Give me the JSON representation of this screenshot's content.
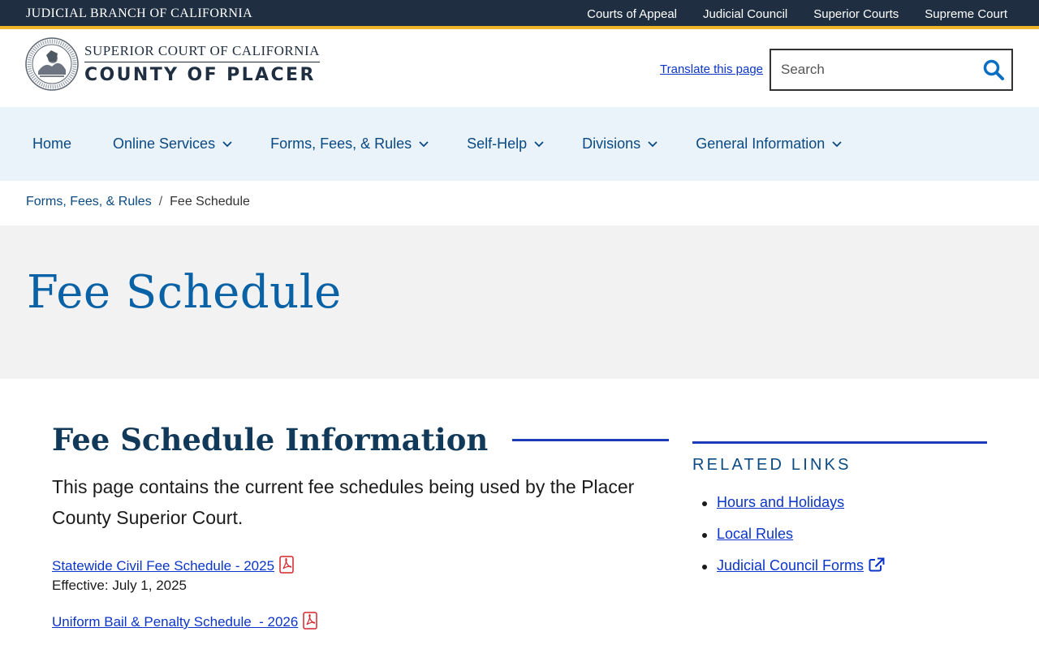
{
  "topbar": {
    "brand": "JUDICIAL BRANCH OF CALIFORNIA",
    "links": [
      "Courts of Appeal",
      "Judicial Council",
      "Superior Courts",
      "Supreme Court"
    ]
  },
  "header": {
    "logo_line1": "SUPERIOR COURT OF CALIFORNIA",
    "logo_line2": "COUNTY OF PLACER",
    "translate": "Translate this page",
    "search_placeholder": "Search"
  },
  "nav": {
    "items": [
      {
        "label": "Home"
      },
      {
        "label": "Online Services"
      },
      {
        "label": "Forms, Fees, & Rules"
      },
      {
        "label": "Self-Help"
      },
      {
        "label": "Divisions"
      },
      {
        "label": "General Information"
      }
    ]
  },
  "breadcrumb": {
    "parent": "Forms, Fees, & Rules",
    "separator": "/",
    "current": "Fee Schedule"
  },
  "hero": {
    "title": "Fee Schedule"
  },
  "main": {
    "heading": "Fee Schedule Information",
    "lead": "This page contains the current fee schedules being used by the Placer County Superior Court.",
    "documents": [
      {
        "label": "Statewide Civil Fee Schedule - 2025",
        "effective": "Effective: July 1, 2025"
      },
      {
        "label": "Uniform Bail & Penalty Schedule  - 2026",
        "effective": ""
      }
    ]
  },
  "related": {
    "heading": "RELATED LINKS",
    "links": [
      "Hours and Holidays",
      "Local Rules",
      "Judicial Council Forms"
    ]
  },
  "colors": {
    "topbar_bg": "#1f2f41",
    "accent_gold": "#f0b429",
    "nav_bg": "#eaf2fa",
    "link_blue": "#0b35c8",
    "heading_navy": "#11395a",
    "hero_title": "#0a62a6",
    "rule_blue": "#1e3bb8",
    "search_icon": "#0a6fc2",
    "pdf_red": "#d3272d"
  },
  "icons": {
    "search": "search-icon",
    "chevron": "chevron-down-icon",
    "pdf": "pdf-icon",
    "external": "external-link-icon",
    "seal": "court-seal-icon"
  }
}
